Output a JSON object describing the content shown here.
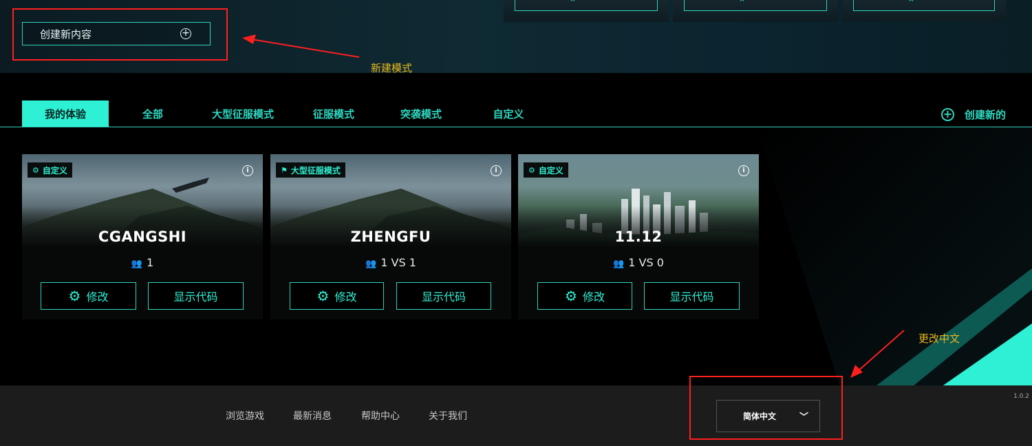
{
  "hero": {
    "create_label": "创建新内容",
    "create_icon": "plus-circle-icon"
  },
  "annotations": {
    "new_mode": "新建模式",
    "change_chinese": "更改中文",
    "color": "#ff1f1f",
    "text_color": "#e8b81c"
  },
  "tabs": [
    {
      "label": "我的体验",
      "active": true
    },
    {
      "label": "全部"
    },
    {
      "label": "大型征服模式"
    },
    {
      "label": "征服模式"
    },
    {
      "label": "突袭模式"
    },
    {
      "label": "自定义"
    }
  ],
  "create_new_label": "创建新的",
  "cards": [
    {
      "badge": "自定义",
      "badge_icon": "gear-icon",
      "title": "CGANGSHI",
      "players": "1",
      "edit_label": "修改",
      "code_label": "显示代码"
    },
    {
      "badge": "大型征服模式",
      "badge_icon": "flag-icon",
      "title": "ZHENGFU",
      "players": "1 VS 1",
      "edit_label": "修改",
      "code_label": "显示代码"
    },
    {
      "badge": "自定义",
      "badge_icon": "gear-icon",
      "title": "11.12",
      "players": "1 VS 0",
      "edit_label": "修改",
      "code_label": "显示代码"
    }
  ],
  "footer": {
    "links": [
      "浏览游戏",
      "最新消息",
      "帮助中心",
      "关于我们"
    ],
    "language": "简体中文",
    "version": "1.0.2"
  },
  "colors": {
    "accent": "#2ef0d4",
    "footer_bg": "#1c1c1c"
  }
}
